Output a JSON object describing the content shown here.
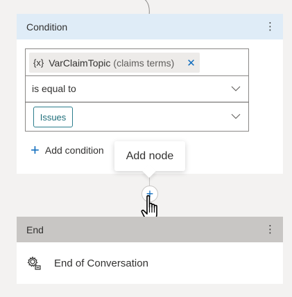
{
  "condition": {
    "title": "Condition",
    "menu_icon": "more-vertical-icon",
    "variable": {
      "type_badge": "{x}",
      "name": "VarClaimTopic",
      "detail": "(claims terms)",
      "remove_icon": "close-icon"
    },
    "operator": "is equal to",
    "value": "Issues",
    "add_condition_label": "Add condition"
  },
  "tooltip": {
    "text": "Add node"
  },
  "add_node_button": {
    "symbol": "+"
  },
  "end": {
    "title": "End",
    "menu_icon": "more-vertical-icon",
    "action_label": "End of Conversation",
    "action_icon": "settings-gear-icon"
  },
  "colors": {
    "condition_header": "#dfecf7",
    "end_header": "#c8c6c4",
    "accent": "#0f6cbd",
    "value_pill": "#2b7d8c",
    "canvas": "#f3f2f1"
  }
}
